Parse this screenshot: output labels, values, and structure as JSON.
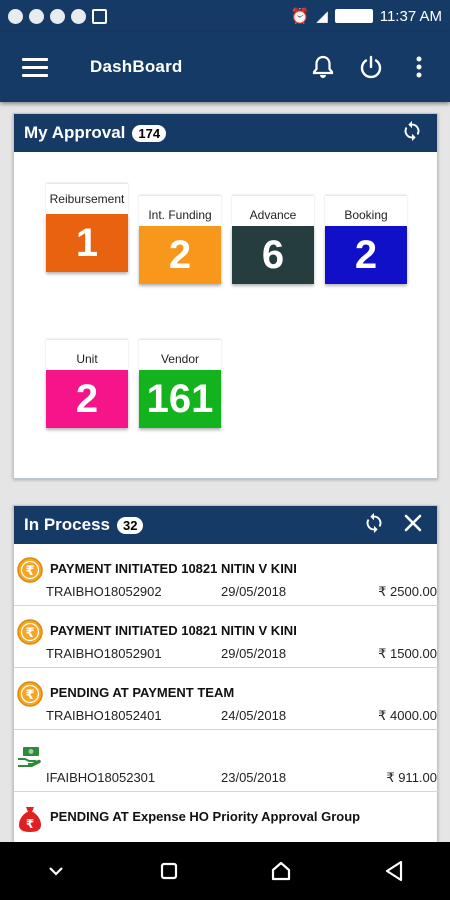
{
  "status_bar": {
    "time": "11:37 AM"
  },
  "app_bar": {
    "title": "DashBoard"
  },
  "approval": {
    "title": "My Approval",
    "count": "174",
    "tiles": [
      {
        "label": "Reibursement",
        "value": "1",
        "color": "#e8620f"
      },
      {
        "label": "Int. Funding",
        "value": "2",
        "color": "#f7981d"
      },
      {
        "label": "Advance",
        "value": "6",
        "color": "#263d40"
      },
      {
        "label": "Booking",
        "value": "2",
        "color": "#1010c8"
      },
      {
        "label": "Unit",
        "value": "2",
        "color": "#f5148a"
      },
      {
        "label": "Vendor",
        "value": "161",
        "color": "#13b31d"
      }
    ]
  },
  "in_process": {
    "title": "In Process",
    "count": "32",
    "rows": [
      {
        "icon": "rupee-coin-icon",
        "status": "PAYMENT INITIATED 10821  NITIN  V KINI",
        "ref": "TRAIBHO18052902",
        "date": "29/05/2018",
        "amount": "₹ 2500.00"
      },
      {
        "icon": "rupee-coin-icon",
        "status": "PAYMENT INITIATED 10821  NITIN  V KINI",
        "ref": "TRAIBHO18052901",
        "date": "29/05/2018",
        "amount": "₹ 1500.00"
      },
      {
        "icon": "rupee-coin-icon",
        "status": "PENDING AT PAYMENT TEAM",
        "ref": "TRAIBHO18052401",
        "date": "24/05/2018",
        "amount": "₹ 4000.00"
      },
      {
        "icon": "money-hand-icon",
        "status": "",
        "ref": "IFAIBHO18052301",
        "date": "23/05/2018",
        "amount": "₹ 911.00"
      },
      {
        "icon": "money-bag-icon",
        "status": "PENDING AT Expense HO Priority Approval Group",
        "ref": "",
        "date": "",
        "amount": ""
      }
    ]
  },
  "colors": {
    "primary": "#163a66",
    "coin": "#f5a623"
  }
}
